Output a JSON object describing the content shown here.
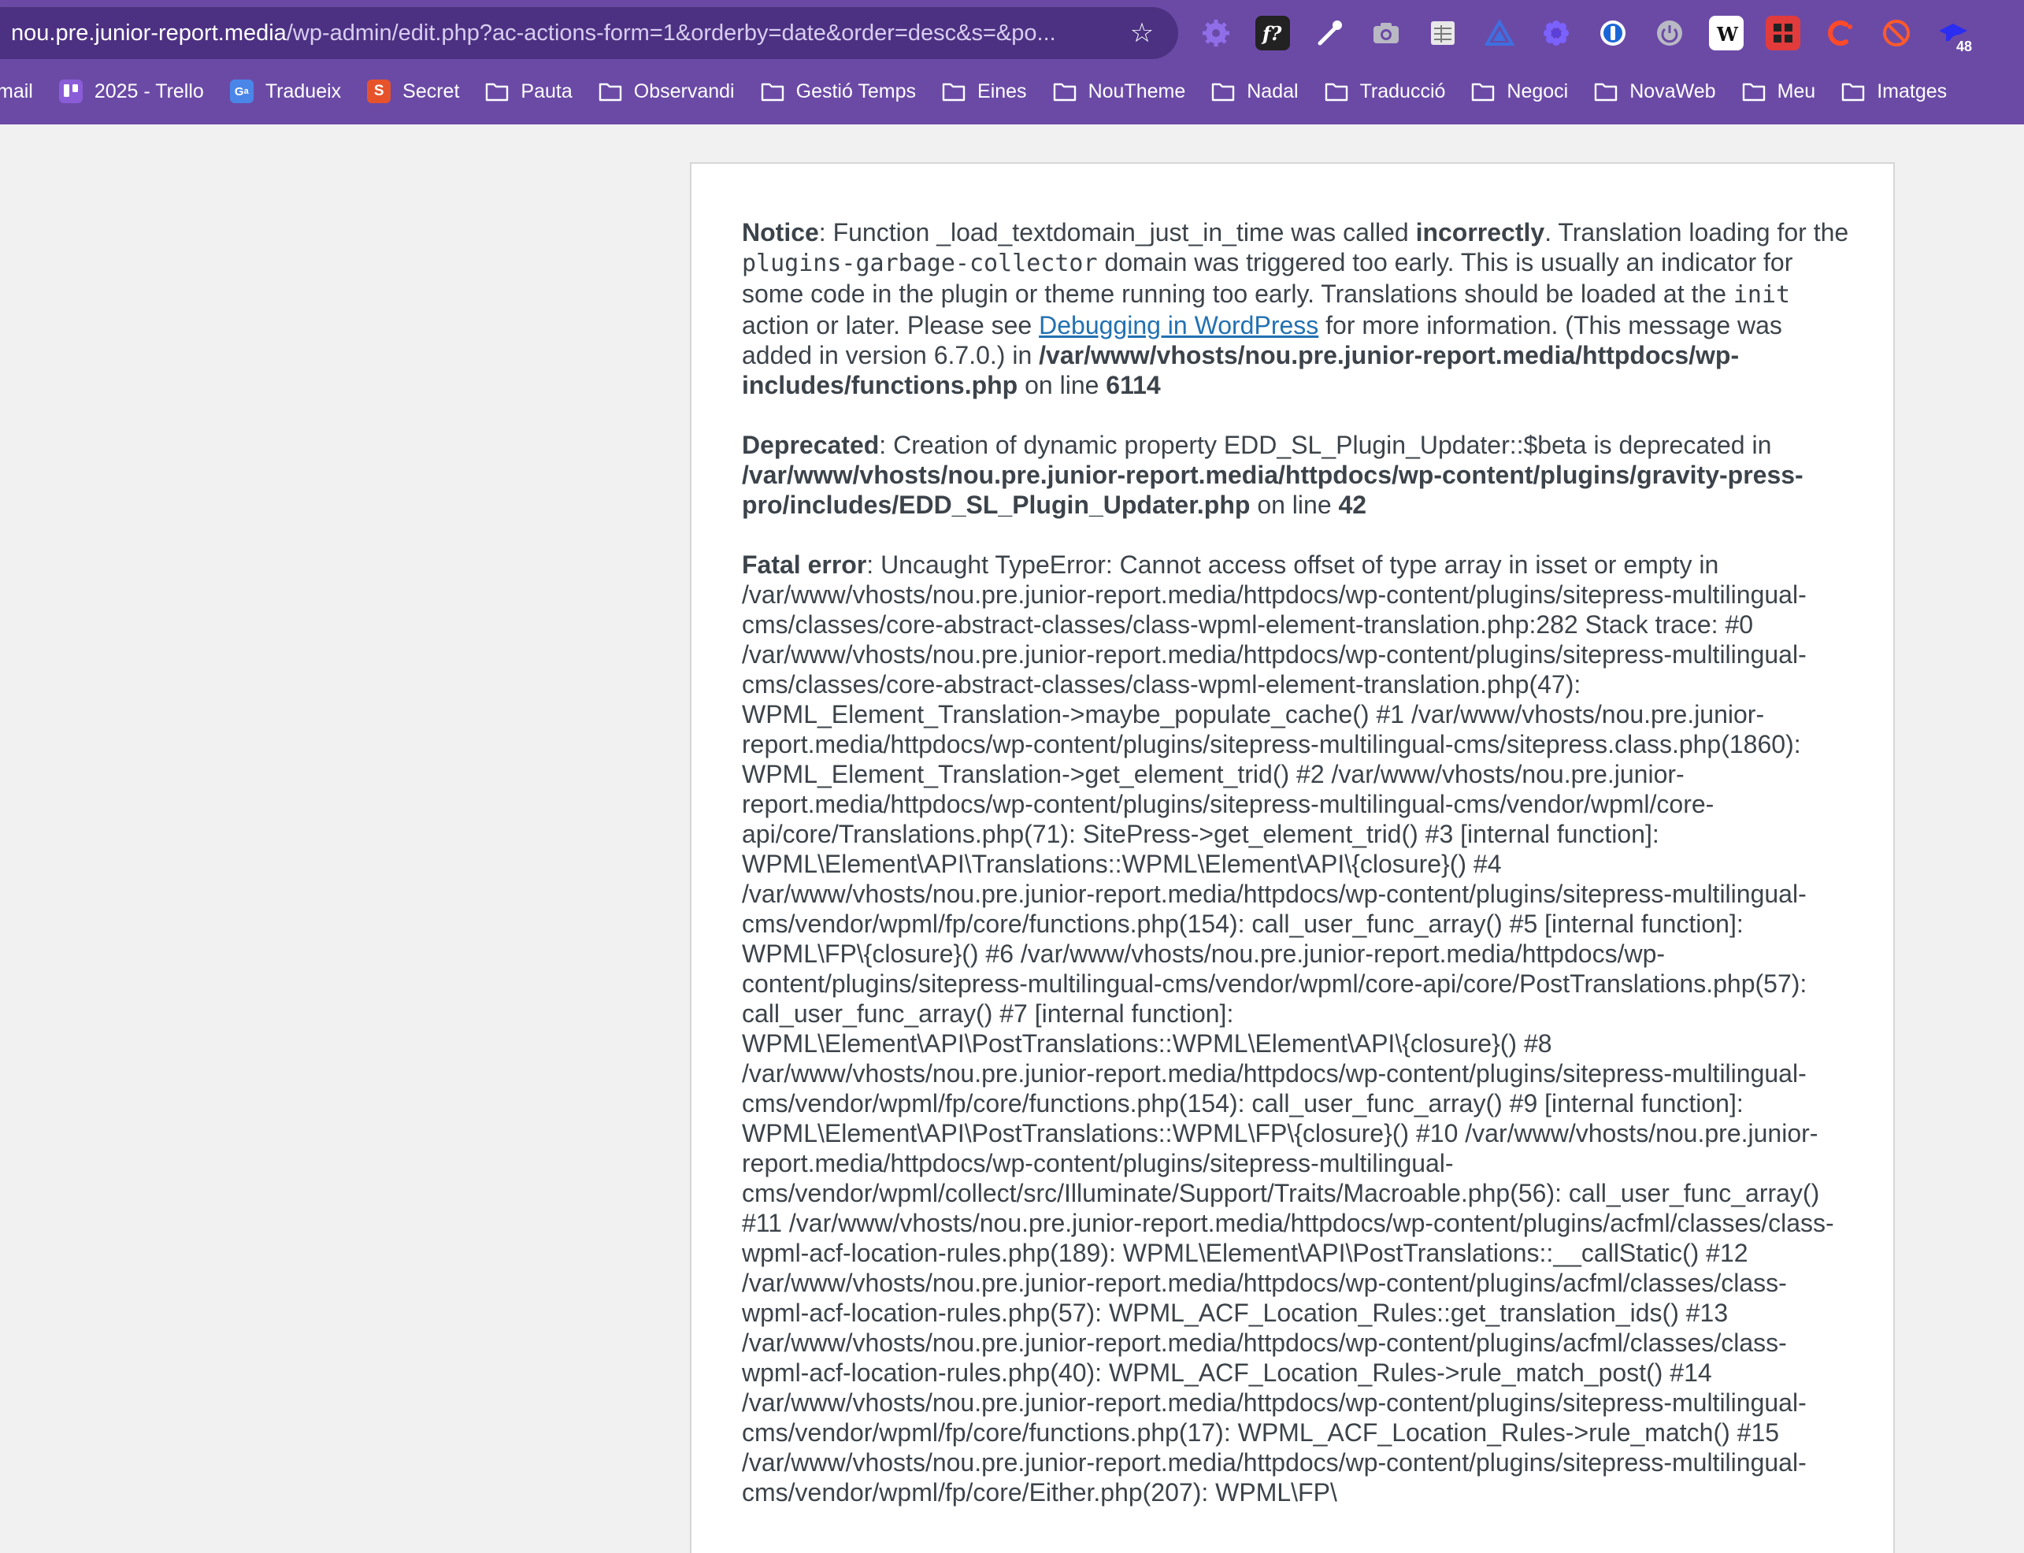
{
  "browser": {
    "url_host": "nou.pre.junior-report.media",
    "url_path": "/wp-admin/edit.php?ac-actions-form=1&orderby=date&order=desc&s=&po...",
    "extension_badge_count": "48",
    "extensions": [
      "gear-extension-icon",
      "fx-extension-icon",
      "eyedropper-extension-icon",
      "camera-extension-icon",
      "sheet-extension-icon",
      "triangle-extension-icon",
      "flower-extension-icon",
      "password-manager-icon",
      "power-extension-icon",
      "w-extension-icon",
      "grid-extension-icon",
      "c-extension-icon",
      "hand-extension-icon",
      "graduation-cap-extension-icon"
    ]
  },
  "bookmarks": [
    {
      "label": "mail",
      "icon": "none"
    },
    {
      "label": "2025 - Trello",
      "icon": "trello"
    },
    {
      "label": "Tradueix",
      "icon": "translate"
    },
    {
      "label": "Secret",
      "icon": "s-badge"
    },
    {
      "label": "Pauta",
      "icon": "folder"
    },
    {
      "label": "Observandi",
      "icon": "folder"
    },
    {
      "label": "Gestió Temps",
      "icon": "folder"
    },
    {
      "label": "Eines",
      "icon": "folder"
    },
    {
      "label": "NouTheme",
      "icon": "folder"
    },
    {
      "label": "Nadal",
      "icon": "folder"
    },
    {
      "label": "Traducció",
      "icon": "folder"
    },
    {
      "label": "Negoci",
      "icon": "folder"
    },
    {
      "label": "NovaWeb",
      "icon": "folder"
    },
    {
      "label": "Meu",
      "icon": "folder"
    },
    {
      "label": "Imatges",
      "icon": "folder"
    }
  ],
  "notice": {
    "label": "Notice",
    "t1": ": Function _load_textdomain_just_in_time was called ",
    "strong": "incorrectly",
    "t2": ". Translation loading for the ",
    "domain": "plugins-garbage-collector",
    "t3": " domain was triggered too early. This is usually an indicator for some code in the plugin or theme running too early. Translations should be loaded at the ",
    "hook": "init",
    "t4": " action or later. Please see ",
    "link": "Debugging in WordPress",
    "t5": " for more information. (This message was added in version 6.7.0.) in ",
    "file": "/var/www/vhosts/nou.pre.junior-report.media/httpdocs/wp-includes/functions.php",
    "t6": " on line ",
    "line": "6114"
  },
  "deprecated": {
    "label": "Deprecated",
    "t1": ": Creation of dynamic property EDD_SL_Plugin_Updater::$beta is deprecated in ",
    "file": "/var/www/vhosts/nou.pre.junior-report.media/httpdocs/wp-content/plugins/gravity-press-pro/includes/EDD_SL_Plugin_Updater.php",
    "t2": " on line ",
    "line": "42"
  },
  "fatal": {
    "label": "Fatal error",
    "text": ": Uncaught TypeError: Cannot access offset of type array in isset or empty in /var/www/vhosts/nou.pre.junior-report.media/httpdocs/wp-content/plugins/sitepress-multilingual-cms/classes/core-abstract-classes/class-wpml-element-translation.php:282 Stack trace: #0 /var/www/vhosts/nou.pre.junior-report.media/httpdocs/wp-content/plugins/sitepress-multilingual-cms/classes/core-abstract-classes/class-wpml-element-translation.php(47): WPML_Element_Translation->maybe_populate_cache() #1 /var/www/vhosts/nou.pre.junior-report.media/httpdocs/wp-content/plugins/sitepress-multilingual-cms/sitepress.class.php(1860): WPML_Element_Translation->get_element_trid() #2 /var/www/vhosts/nou.pre.junior-report.media/httpdocs/wp-content/plugins/sitepress-multilingual-cms/vendor/wpml/core-api/core/Translations.php(71): SitePress->get_element_trid() #3 [internal function]: WPML\\Element\\API\\Translations::WPML\\Element\\API\\{closure}() #4 /var/www/vhosts/nou.pre.junior-report.media/httpdocs/wp-content/plugins/sitepress-multilingual-cms/vendor/wpml/fp/core/functions.php(154): call_user_func_array() #5 [internal function]: WPML\\FP\\{closure}() #6 /var/www/vhosts/nou.pre.junior-report.media/httpdocs/wp-content/plugins/sitepress-multilingual-cms/vendor/wpml/core-api/core/PostTranslations.php(57): call_user_func_array() #7 [internal function]: WPML\\Element\\API\\PostTranslations::WPML\\Element\\API\\{closure}() #8 /var/www/vhosts/nou.pre.junior-report.media/httpdocs/wp-content/plugins/sitepress-multilingual-cms/vendor/wpml/fp/core/functions.php(154): call_user_func_array() #9 [internal function]: WPML\\Element\\API\\PostTranslations::WPML\\FP\\{closure}() #10 /var/www/vhosts/nou.pre.junior-report.media/httpdocs/wp-content/plugins/sitepress-multilingual-cms/vendor/wpml/collect/src/Illuminate/Support/Traits/Macroable.php(56): call_user_func_array() #11 /var/www/vhosts/nou.pre.junior-report.media/httpdocs/wp-content/plugins/acfml/classes/class-wpml-acf-location-rules.php(189): WPML\\Element\\API\\PostTranslations::__callStatic() #12 /var/www/vhosts/nou.pre.junior-report.media/httpdocs/wp-content/plugins/acfml/classes/class-wpml-acf-location-rules.php(57): WPML_ACF_Location_Rules::get_translation_ids() #13 /var/www/vhosts/nou.pre.junior-report.media/httpdocs/wp-content/plugins/acfml/classes/class-wpml-acf-location-rules.php(40): WPML_ACF_Location_Rules->rule_match_post() #14 /var/www/vhosts/nou.pre.junior-report.media/httpdocs/wp-content/plugins/sitepress-multilingual-cms/vendor/wpml/fp/core/functions.php(17): WPML_ACF_Location_Rules->rule_match() #15 /var/www/vhosts/nou.pre.junior-report.media/httpdocs/wp-content/plugins/sitepress-multilingual-cms/vendor/wpml/fp/core/Either.php(207): WPML\\FP\\"
  },
  "colors": {
    "chrome": "#6b4aa6",
    "omnibox": "#4c3182",
    "page_bg": "#f1f1f1",
    "text": "#3c434a",
    "link": "#2271b1"
  }
}
